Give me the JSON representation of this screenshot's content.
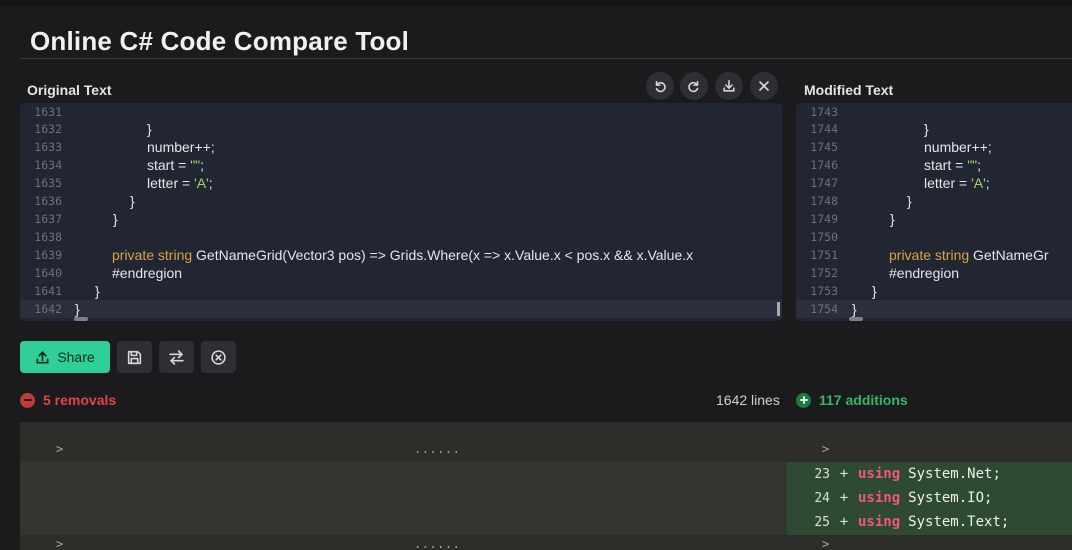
{
  "header": {
    "title": "Online C# Code Compare Tool"
  },
  "panels": {
    "original_label": "Original Text",
    "modified_label": "Modified Text"
  },
  "toolbar_icons": [
    "undo-icon",
    "redo-icon",
    "download-icon",
    "close-icon"
  ],
  "original_editor": {
    "lines": [
      {
        "num": "1631",
        "code": ""
      },
      {
        "num": "1632",
        "code": "            }"
      },
      {
        "num": "1633",
        "code": "            number++;"
      },
      {
        "num": "1634",
        "code": "            start = \"\";"
      },
      {
        "num": "1635",
        "code": "            letter = 'A';"
      },
      {
        "num": "1636",
        "code": "        }"
      },
      {
        "num": "1637",
        "code": "    }"
      },
      {
        "num": "1638",
        "code": ""
      },
      {
        "num": "1639",
        "code": "private string GetNameGrid(Vector3 pos) => Grids.Where(x => x.Value.x < pos.x && x.Value.x"
      },
      {
        "num": "1640",
        "code": "#endregion"
      },
      {
        "num": "1641",
        "code": "}"
      },
      {
        "num": "1642",
        "code": "}"
      }
    ]
  },
  "modified_editor": {
    "lines": [
      {
        "num": "1743",
        "code": ""
      },
      {
        "num": "1744",
        "code": "            }"
      },
      {
        "num": "1745",
        "code": "            number++;"
      },
      {
        "num": "1746",
        "code": "            start = \"\";"
      },
      {
        "num": "1747",
        "code": "            letter = 'A';"
      },
      {
        "num": "1748",
        "code": "        }"
      },
      {
        "num": "1749",
        "code": "    }"
      },
      {
        "num": "1750",
        "code": ""
      },
      {
        "num": "1751",
        "code": "private string GetNameGr"
      },
      {
        "num": "1752",
        "code": "#endregion"
      },
      {
        "num": "1753",
        "code": "}"
      },
      {
        "num": "1754",
        "code": "}"
      }
    ]
  },
  "actions": {
    "share_label": "Share",
    "icons": [
      "save-icon",
      "swap-icon",
      "clear-icon"
    ]
  },
  "stats": {
    "removals": "5 removals",
    "lines": "1642 lines",
    "additions": "117 additions"
  },
  "diff": {
    "caret": ">",
    "ellipsis": "......",
    "added_lines": [
      {
        "num": "23",
        "sign": "+",
        "keyword": "using",
        "text": "System.Net;"
      },
      {
        "num": "24",
        "sign": "+",
        "keyword": "using",
        "text": "System.IO;"
      },
      {
        "num": "25",
        "sign": "+",
        "keyword": "using",
        "text": "System.Text;"
      }
    ]
  },
  "colors": {
    "accent": "#2fcf97",
    "removal": "#e04545",
    "addition": "#35b863",
    "keyword": "#d9a441",
    "string": "#a6d66a",
    "diff_keyword": "#f0557a"
  }
}
